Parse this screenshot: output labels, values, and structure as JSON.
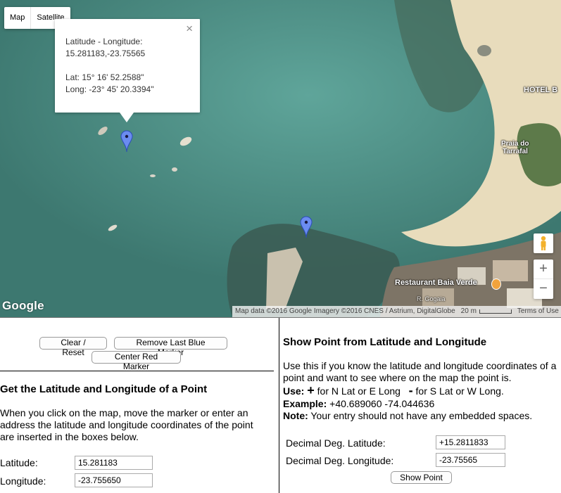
{
  "map": {
    "map_type": {
      "map_label": "Map",
      "satellite_label": "Satellite"
    },
    "infowindow": {
      "title": "Latitude - Longitude:",
      "latlng": "15.281183,-23.75565",
      "lat_dms": "Lat: 15° 16' 52.2588\"",
      "lng_dms": "Long: -23° 45' 20.3394\"",
      "close": "×"
    },
    "labels": {
      "hotel": "HOTEL B",
      "beach_line1": "Praia do",
      "beach_line2": "Tarrafal",
      "restaurant": "Restaurant Baia Verde",
      "road": "R. Gogaia"
    },
    "logo": "Google",
    "attribution": "Map data ©2016 Google Imagery ©2016 CNES / Astrium, DigitalGlobe",
    "scale": "20 m",
    "terms": "Terms of Use",
    "zoom": {
      "in": "+",
      "out": "−"
    },
    "colors": {
      "marker_blue": "#6b8cf0",
      "water": "#3f7a72",
      "sand": "#e9dcbc"
    }
  },
  "left": {
    "buttons": {
      "clear": "Clear / Reset",
      "remove": "Remove Last Blue Marker",
      "center": "Center Red Marker"
    },
    "heading": "Get the Latitude and Longitude of a Point",
    "description": "When you click on the map, move the marker or enter an address the latitude and longitude coordinates of the point are inserted in the boxes below.",
    "latitude_label": "Latitude:",
    "latitude_value": "15.281183",
    "longitude_label": "Longitude:",
    "longitude_value": "-23.755650"
  },
  "right": {
    "heading": "Show Point from Latitude and Longitude",
    "intro": "Use this if you know the latitude and longitude coordinates of a point and want to see where on the map the point is.",
    "use_label": "Use:",
    "plus_symbol": "+",
    "plus_text": " for N Lat or E Long",
    "minus_symbol": "-",
    "minus_text": " for S Lat or W Long.",
    "example_label": "Example:",
    "example_text": " +40.689060  -74.044636",
    "note_label": "Note:",
    "note_text": " Your entry should not have any embedded spaces.",
    "dec_lat_label": "Decimal Deg. Latitude:",
    "dec_lat_value": "+15.2811833",
    "dec_lng_label": "Decimal Deg. Longitude:",
    "dec_lng_value": "-23.75565",
    "show_button": "Show Point"
  }
}
